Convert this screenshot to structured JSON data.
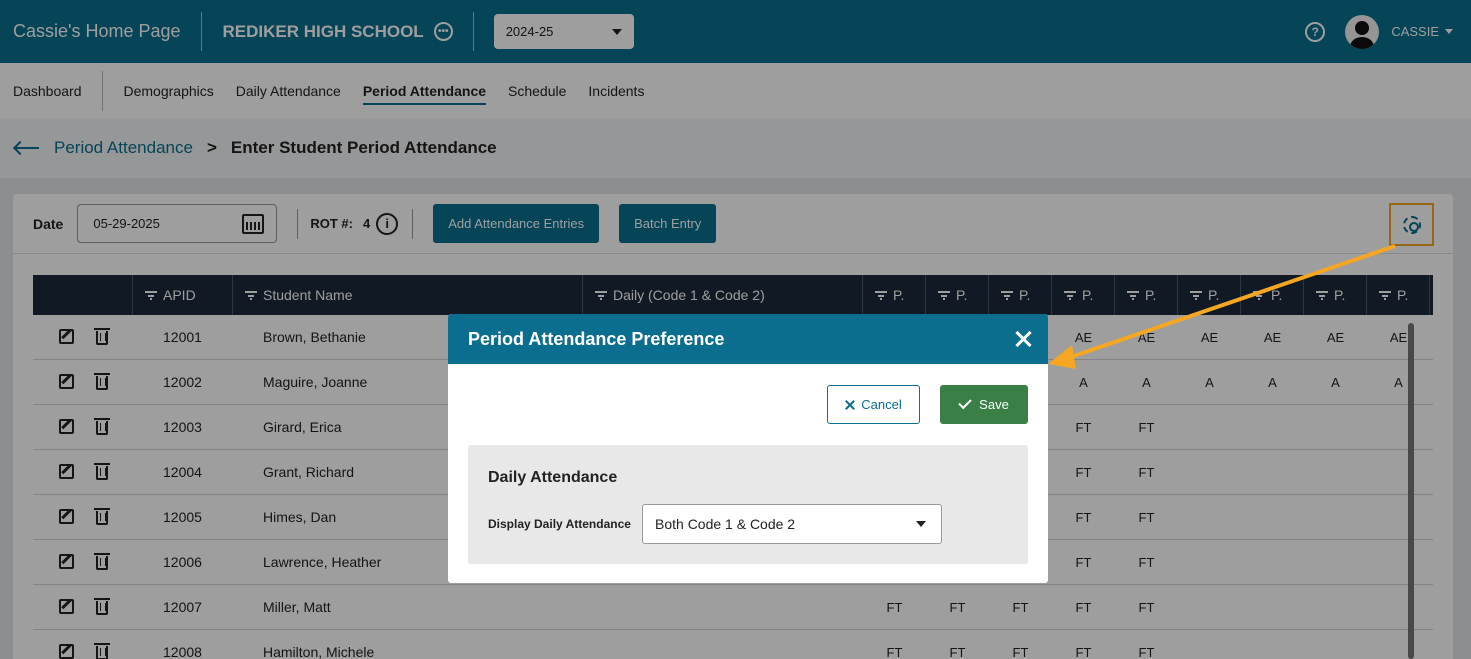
{
  "header": {
    "home_title": "Cassie's Home Page",
    "school_name": "REDIKER HIGH SCHOOL",
    "school_year": "2024-25",
    "user_name": "CASSIE"
  },
  "nav": {
    "items": [
      "Dashboard",
      "Demographics",
      "Daily Attendance",
      "Period Attendance",
      "Schedule",
      "Incidents"
    ],
    "active": "Period Attendance"
  },
  "breadcrumb": {
    "parent": "Period Attendance",
    "current": "Enter Student Period Attendance"
  },
  "toolbar": {
    "date_label": "Date",
    "date_value": "05-29-2025",
    "rot_label": "ROT #:",
    "rot_value": "4",
    "info_glyph": "i",
    "add_button": "Add Attendance Entries",
    "batch_button": "Batch Entry"
  },
  "grid": {
    "headers": {
      "apid": "APID",
      "name": "Student Name",
      "daily": "Daily (Code 1 & Code 2)",
      "p": [
        "P.",
        "P.",
        "P.",
        "P.",
        "P.",
        "P.",
        "P.",
        "P.",
        "P."
      ]
    },
    "rows": [
      {
        "apid": "12001",
        "name": "Brown, Bethanie",
        "p": [
          "",
          "",
          "",
          "AE",
          "AE",
          "AE",
          "AE",
          "AE",
          "AE"
        ]
      },
      {
        "apid": "12002",
        "name": "Maguire, Joanne",
        "p": [
          "",
          "",
          "",
          "A",
          "A",
          "A",
          "A",
          "A",
          "A"
        ]
      },
      {
        "apid": "12003",
        "name": "Girard, Erica",
        "p": [
          "",
          "",
          "",
          "FT",
          "FT",
          "",
          "",
          "",
          ""
        ]
      },
      {
        "apid": "12004",
        "name": "Grant, Richard",
        "p": [
          "",
          "",
          "",
          "FT",
          "FT",
          "",
          "",
          "",
          ""
        ]
      },
      {
        "apid": "12005",
        "name": "Himes, Dan",
        "p": [
          "",
          "",
          "",
          "FT",
          "FT",
          "",
          "",
          "",
          ""
        ]
      },
      {
        "apid": "12006",
        "name": "Lawrence, Heather",
        "p": [
          "",
          "",
          "",
          "FT",
          "FT",
          "",
          "",
          "",
          ""
        ]
      },
      {
        "apid": "12007",
        "name": "Miller, Matt",
        "p": [
          "FT",
          "FT",
          "FT",
          "FT",
          "FT",
          "",
          "",
          "",
          ""
        ]
      },
      {
        "apid": "12008",
        "name": "Hamilton, Michele",
        "p": [
          "FT",
          "FT",
          "FT",
          "FT",
          "FT",
          "",
          "",
          "",
          ""
        ]
      }
    ]
  },
  "modal": {
    "title": "Period Attendance Preference",
    "cancel_label": "Cancel",
    "save_label": "Save",
    "section_title": "Daily Attendance",
    "field_label": "Display Daily Attendance",
    "field_value": "Both Code 1 & Code 2"
  },
  "colors": {
    "primary": "#0b6e8e",
    "save": "#3a7f45",
    "highlight": "#f5a623",
    "grid_header": "#1c2b3a"
  }
}
